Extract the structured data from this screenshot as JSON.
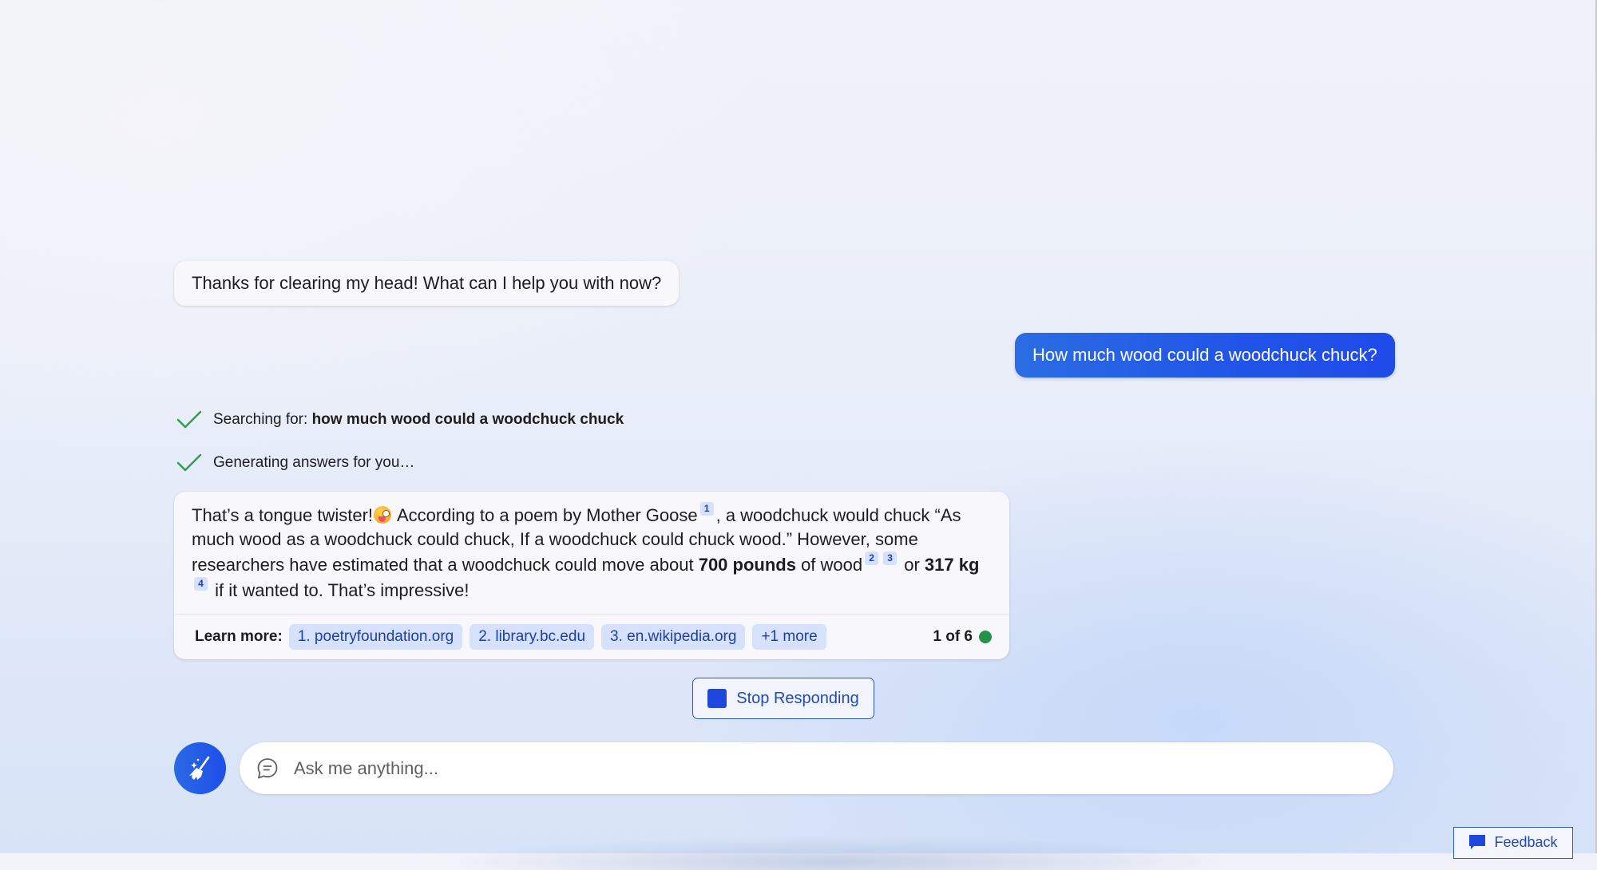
{
  "conversation": {
    "bot_greeting": "Thanks for clearing my head! What can I help you with now?",
    "user_message": "How much wood could a woodchuck chuck?",
    "status": [
      {
        "icon": "check-icon",
        "prefix": "Searching for: ",
        "bold": "how much wood could a woodchuck chuck"
      },
      {
        "icon": "check-icon",
        "prefix": "Generating answers for you…",
        "bold": ""
      }
    ],
    "answer": {
      "seg1": "That’s a tongue twister!",
      "emoji": "winking-face-with-tongue",
      "seg2": " According to a poem by Mother Goose",
      "cite1": "1",
      "seg3": ", a woodchuck would chuck “As much wood as a woodchuck could chuck, If a woodchuck could chuck wood.” However, some researchers have estimated that a woodchuck could move about ",
      "bold1": "700 pounds",
      "seg4": " of wood",
      "cite2": "2",
      "cite3": "3",
      "seg5": " or ",
      "bold2": "317 kg",
      "cite4": "4",
      "seg6": " if it wanted to. That’s impressive!"
    },
    "learn_more": {
      "label": "Learn more:",
      "sources": [
        {
          "label": "1. poetryfoundation.org"
        },
        {
          "label": "2. library.bc.edu"
        },
        {
          "label": "3. en.wikipedia.org"
        },
        {
          "label": "+1 more"
        }
      ],
      "turn_counter": "1 of 6",
      "turn_indicator_color": "#23924a"
    }
  },
  "controls": {
    "stop_label": "Stop Responding",
    "new_topic_icon": "broom-icon",
    "input_placeholder": "Ask me anything...",
    "input_value": "",
    "feedback_label": "Feedback"
  },
  "colors": {
    "accent": "#1f4be9",
    "user_bubble": "#2054e8",
    "chip_bg": "#d6e1fb",
    "chip_text": "#1f3fa8",
    "check": "#2aa04a"
  }
}
